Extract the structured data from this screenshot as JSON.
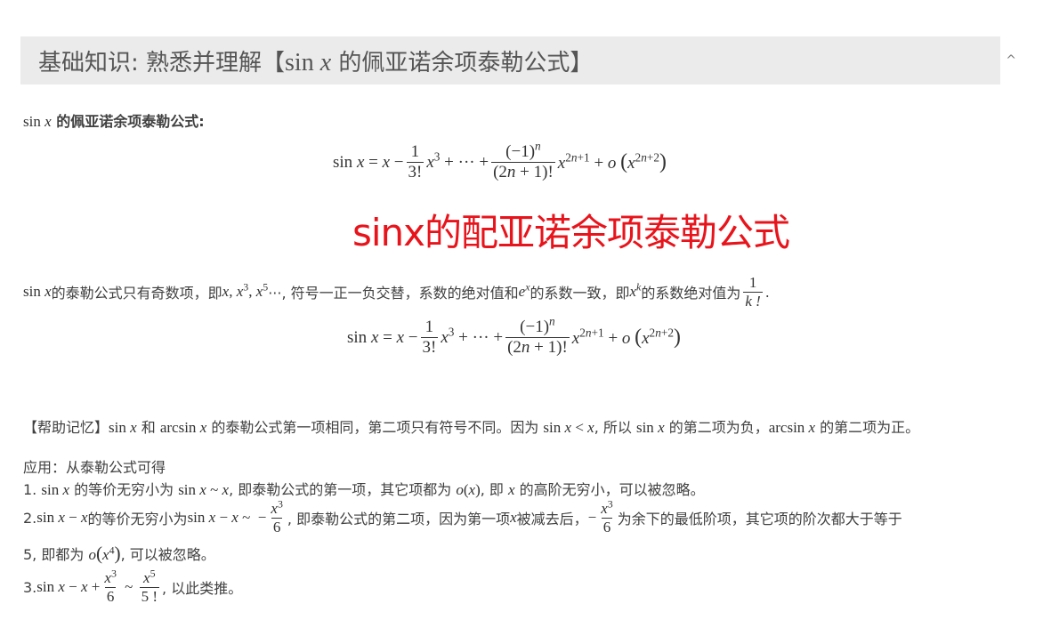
{
  "header": {
    "title_prefix": "基础知识: 熟悉并理解【",
    "title_math": "sin x",
    "title_suffix": " 的佩亚诺余项泰勒公式】",
    "collapse_icon": "^"
  },
  "section_title": {
    "math": "sin x",
    "text": " 的佩亚诺余项泰勒公式:"
  },
  "formula": {
    "lhs": "sin x = x −",
    "f1_num": "1",
    "f1_den": "3!",
    "mid": "+ ··· +",
    "f2_num": "(−1)",
    "f2_num_sup": "n",
    "f2_den": "(2n + 1)!",
    "x_exp": "2n+1",
    "tail": "+ o",
    "o_exp": "2n+2"
  },
  "annotation": "sinx的配亚诺余项泰勒公式",
  "explain": {
    "p1": " 的泰勒公式只有奇数项，即 ",
    "p2": "···, 符号一正一负交替，系数的绝对值和 ",
    "p3": " 的系数一致，即 ",
    "p4": " 的系数绝对值为 ",
    "frac_num": "1",
    "frac_den": "k !",
    "end": "."
  },
  "help": {
    "label": "【帮助记忆】",
    "t1": " 和 ",
    "t2": " 的泰勒公式第一项相同，第二项只有符号不同。因为 ",
    "t3": ", 所以 ",
    "t4": " 的第二项为负，",
    "t5": " 的第二项为正。"
  },
  "application": {
    "heading": "应用：从泰勒公式可得",
    "i1_a": "1. ",
    "i1_b": " 的等价无穷小为 ",
    "i1_c": ", 即泰勒公式的第一项，其它项都为 ",
    "i1_d": ", 即 ",
    "i1_e": " 的高阶无穷小，可以被忽略。",
    "i2_a": "2. ",
    "i2_b": " 的等价无穷小为 ",
    "i2_c": ", 即泰勒公式的第二项，因为第一项 ",
    "i2_d": " 被减去后，",
    "i2_e": " 为余下的最低阶项，其它项的阶次都大于等于",
    "i2_f": "5, 即都为 ",
    "i2_g": ", 可以被忽略。",
    "i3_a": "3. ",
    "i3_b": ", 以此类推。"
  }
}
